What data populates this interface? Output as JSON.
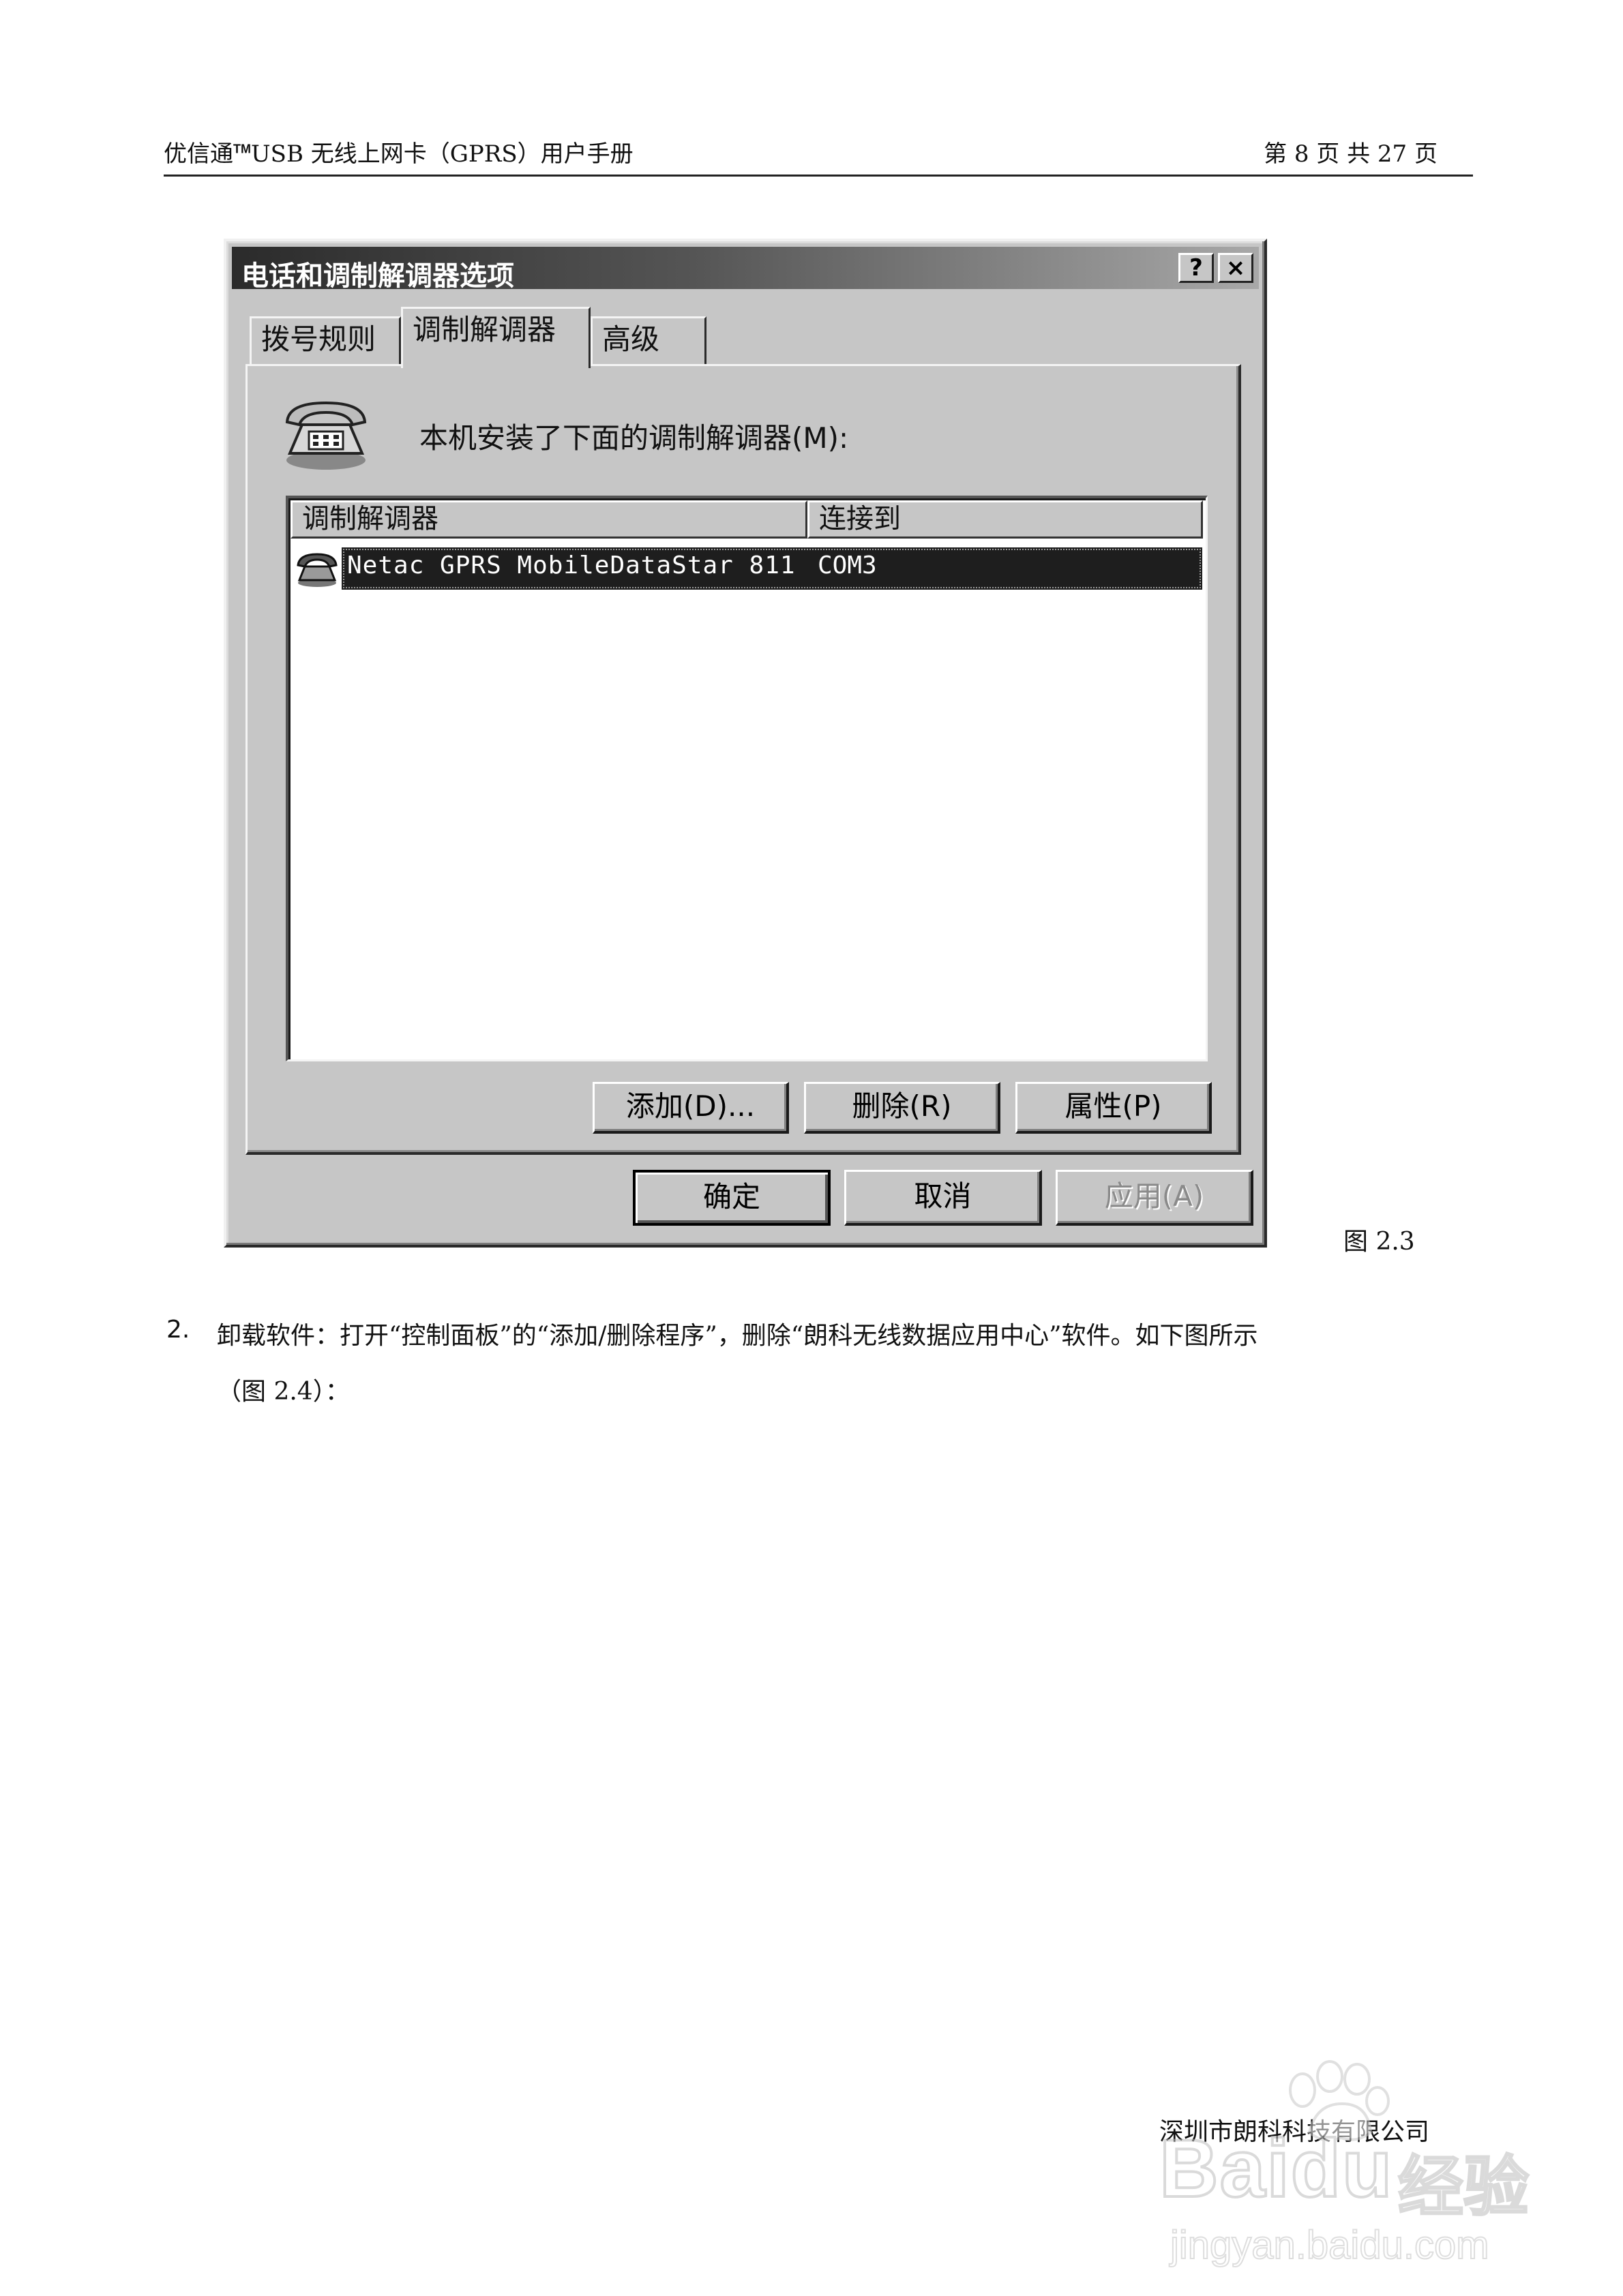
{
  "header": {
    "product": "优信通",
    "tm": "TM",
    "title_rest": "USB 无线上网卡（GPRS）用户手册",
    "page_info": "第 8  页  共  27  页"
  },
  "dialog": {
    "title": "电话和调制解调器选项",
    "help_button": "?",
    "close_button": "×",
    "tabs": [
      {
        "label": "拨号规则"
      },
      {
        "label": "调制解调器",
        "active": true
      },
      {
        "label": "高级"
      }
    ],
    "intro_text": "本机安装了下面的调制解调器(M):",
    "list": {
      "columns": [
        "调制解调器",
        "连接到"
      ],
      "rows": [
        {
          "modem": "Netac GPRS MobileDataStar 811",
          "port": "COM3",
          "selected": true
        }
      ]
    },
    "buttons": {
      "add": "添加(D)...",
      "remove": "删除(R)",
      "properties": "属性(P)",
      "ok": "确定",
      "cancel": "取消",
      "apply": "应用(A)"
    },
    "icons": {
      "title_phone": "telephone-icon",
      "row_modem": "modem-icon"
    }
  },
  "figure_caption": "图 2.3",
  "step": {
    "number": "2.",
    "text_line1": "卸载软件：打开“控制面板”的“添加/删除程序”，删除“朗科无线数据应用中心”软件。如下图所示",
    "text_line2": "（图 2.4）："
  },
  "footer": {
    "company": "深圳市朗科科技有限公司"
  },
  "watermark": {
    "brand": "Baidu",
    "brand_cn": "经验",
    "url": "jingyan.baidu.com"
  }
}
